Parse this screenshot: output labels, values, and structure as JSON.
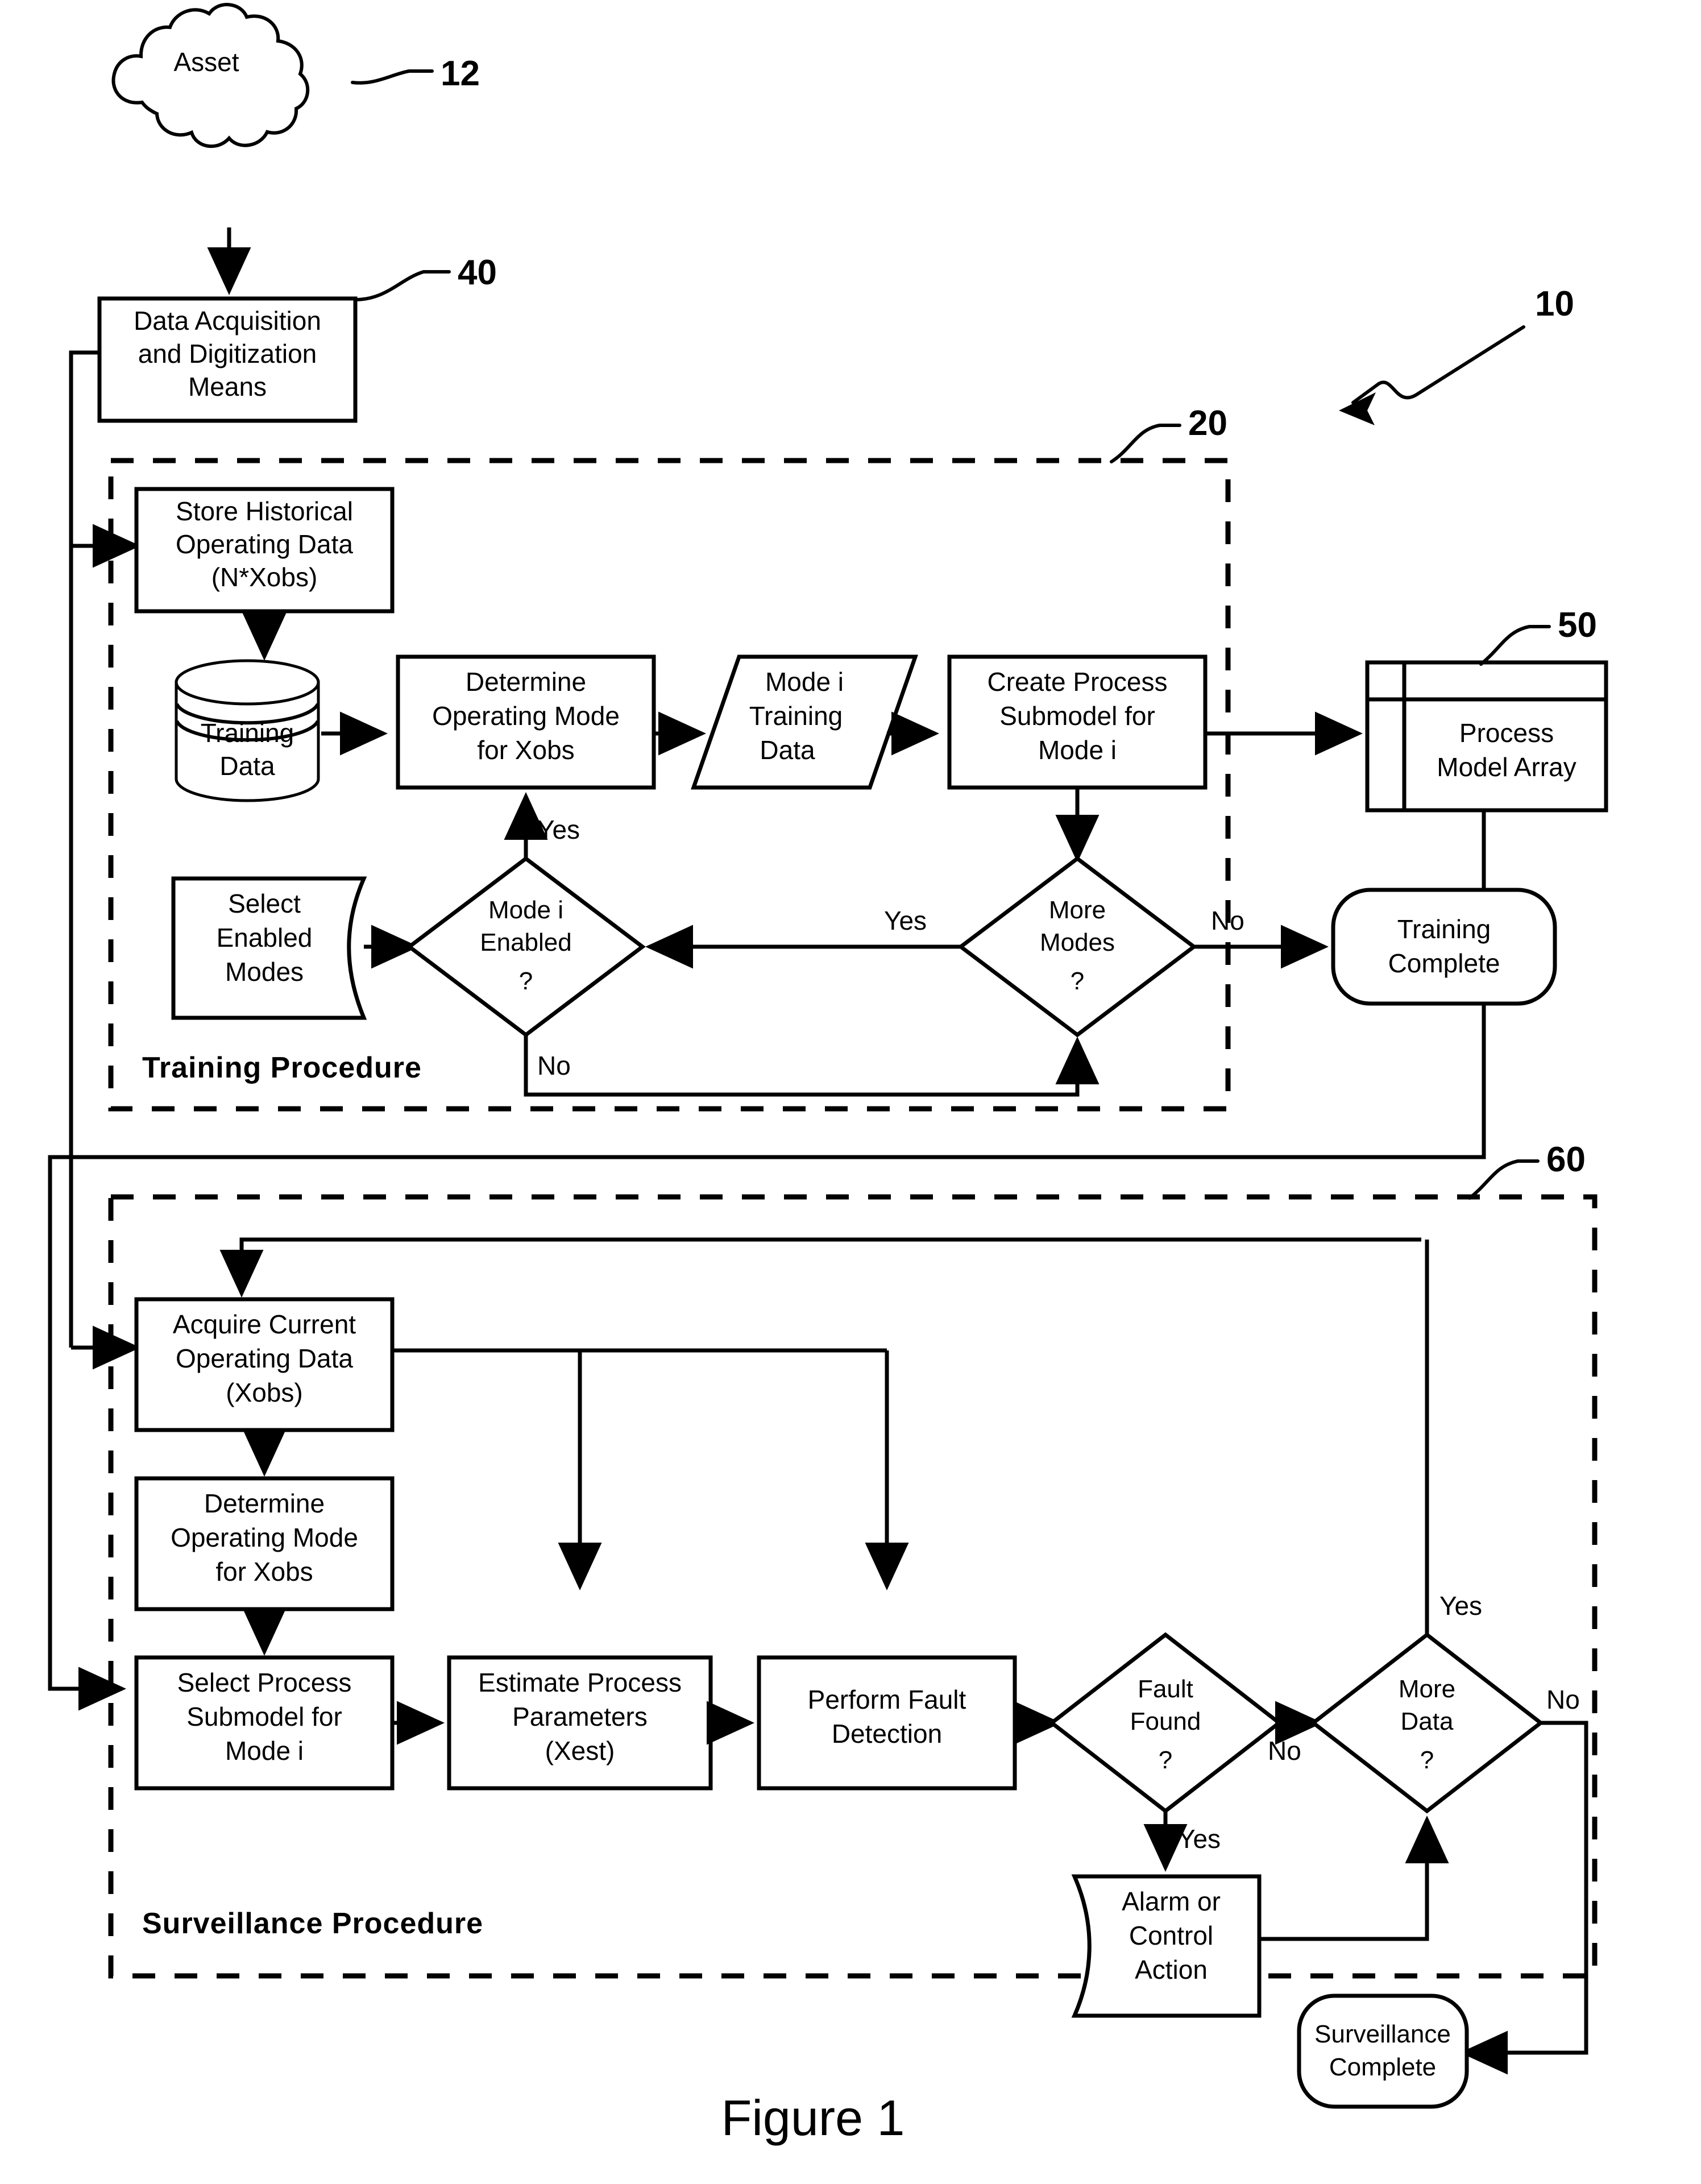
{
  "figure": {
    "caption": "Figure 1",
    "system_ref": "10"
  },
  "nodes": {
    "asset": {
      "label": "Asset",
      "ref": "12",
      "shape": "cloud"
    },
    "daq": {
      "lines": [
        "Data Acquisition",
        "and Digitization",
        "Means"
      ],
      "ref": "40",
      "shape": "process"
    },
    "store_historical": {
      "lines": [
        "Store Historical",
        "Operating Data",
        "(N*Xobs)"
      ],
      "shape": "process"
    },
    "training_data": {
      "lines": [
        "Training",
        "Data"
      ],
      "shape": "database"
    },
    "determine_mode_train": {
      "lines": [
        "Determine",
        "Operating Mode",
        "for Xobs"
      ],
      "shape": "process"
    },
    "mode_i_training_data": {
      "lines": [
        "Mode i",
        "Training",
        "Data"
      ],
      "shape": "data-parallelogram"
    },
    "create_submodel": {
      "lines": [
        "Create Process",
        "Submodel for",
        "Mode i"
      ],
      "shape": "process"
    },
    "process_model_array": {
      "lines": [
        "Process",
        "Model Array"
      ],
      "ref": "50",
      "shape": "stacked-array"
    },
    "select_enabled_modes": {
      "lines": [
        "Select",
        "Enabled",
        "Modes"
      ],
      "shape": "manual-input"
    },
    "mode_i_enabled": {
      "lines": [
        "Mode i",
        "Enabled",
        "?"
      ],
      "shape": "decision"
    },
    "more_modes": {
      "lines": [
        "More",
        "Modes",
        "?"
      ],
      "shape": "decision"
    },
    "training_complete": {
      "lines": [
        "Training",
        "Complete"
      ],
      "shape": "terminator"
    },
    "acquire_current": {
      "lines": [
        "Acquire Current",
        "Operating Data",
        "(Xobs)"
      ],
      "shape": "process"
    },
    "determine_mode_surv": {
      "lines": [
        "Determine",
        "Operating Mode",
        "for Xobs"
      ],
      "shape": "process"
    },
    "select_submodel": {
      "lines": [
        "Select Process",
        "Submodel for",
        "Mode i"
      ],
      "shape": "process"
    },
    "estimate_params": {
      "lines": [
        "Estimate Process",
        "Parameters",
        "(Xest)"
      ],
      "shape": "process"
    },
    "perform_fault_detection": {
      "lines": [
        "Perform Fault",
        "Detection"
      ],
      "shape": "process"
    },
    "fault_found": {
      "lines": [
        "Fault",
        "Found",
        "?"
      ],
      "shape": "decision"
    },
    "more_data": {
      "lines": [
        "More",
        "Data",
        "?"
      ],
      "shape": "decision"
    },
    "alarm_or_control": {
      "lines": [
        "Alarm or",
        "Control",
        "Action"
      ],
      "shape": "manual-operation"
    },
    "surveillance_complete": {
      "lines": [
        "Surveillance",
        "Complete"
      ],
      "shape": "terminator"
    }
  },
  "groups": {
    "training": {
      "label": "Training Procedure",
      "ref": "20"
    },
    "surveillance": {
      "label": "Surveillance  Procedure",
      "ref": "60"
    }
  },
  "edge_labels": {
    "mode_enabled_yes": "Yes",
    "mode_enabled_no": "No",
    "more_modes_yes": "Yes",
    "more_modes_no": "No",
    "fault_found_no": "No",
    "fault_found_yes": "Yes",
    "more_data_yes": "Yes",
    "more_data_no": "No"
  },
  "colors": {
    "stroke": "#000000",
    "fill": "#ffffff",
    "background": "#ffffff"
  }
}
